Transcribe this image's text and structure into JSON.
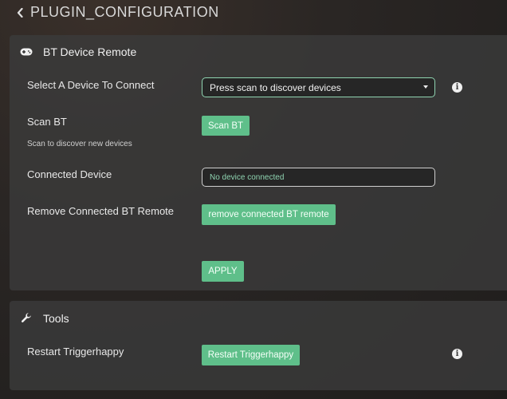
{
  "header": {
    "title": "PLUGIN_CONFIGURATION"
  },
  "bt_panel": {
    "title": "BT Device Remote",
    "icon": "gamepad-icon",
    "select_device": {
      "label": "Select A Device To Connect",
      "value": "Press scan to discover devices"
    },
    "scan": {
      "label": "Scan BT",
      "description": "Scan to discover new devices",
      "button": "Scan BT"
    },
    "connected": {
      "label": "Connected Device",
      "value": "No device connected"
    },
    "remove": {
      "label": "Remove Connected BT Remote",
      "button": "remove connected BT remote"
    },
    "apply_button": "APPLY"
  },
  "tools_panel": {
    "title": "Tools",
    "icon": "wrench-icon",
    "restart": {
      "label": "Restart Triggerhappy",
      "button": "Restart Triggerhappy"
    }
  },
  "colors": {
    "accent": "#5fbf8a",
    "accent_light": "#8fd4b1",
    "panel": "#3a3a3a"
  }
}
